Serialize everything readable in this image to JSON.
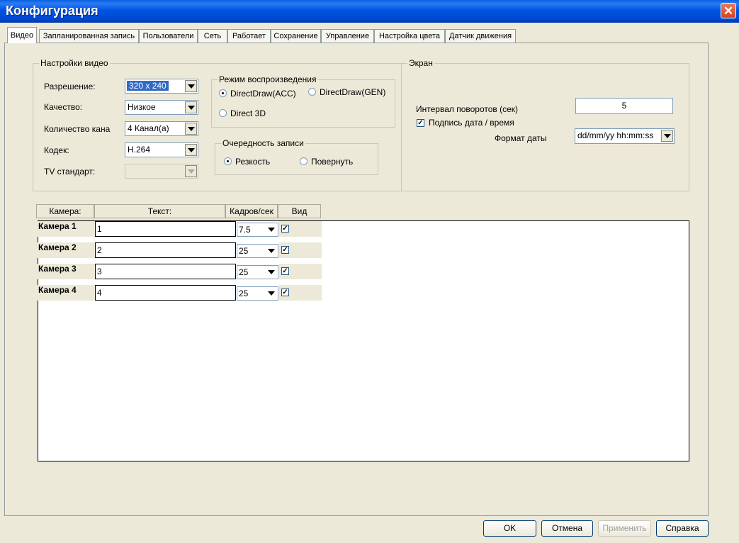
{
  "window": {
    "title": "Конфигурация"
  },
  "tabs": [
    "Видео",
    "Запланированная запись",
    "Пользователи",
    "Сеть",
    "Работает",
    "Сохранение",
    "Управление",
    "Настройка цвета",
    "Датчик движения"
  ],
  "video_settings": {
    "legend": "Настройки видео",
    "resolution_label": "Разрешение:",
    "resolution_value": "320 x 240",
    "quality_label": "Качество:",
    "quality_value": "Низкое",
    "channels_label": "Количество кана",
    "channels_value": "4 Канал(а)",
    "codec_label": "Кодек:",
    "codec_value": "H.264",
    "tv_label": "TV стандарт:",
    "tv_value": ""
  },
  "playback_mode": {
    "legend": "Режим воспроизведения",
    "option1": "DirectDraw(ACC)",
    "option2": "DirectDraw(GEN)",
    "option3": "Direct 3D",
    "selected": "DirectDraw(ACC)"
  },
  "record_order": {
    "legend": "Очередность записи",
    "option1": "Резкость",
    "option2": "Повернуть",
    "selected": "Резкость"
  },
  "screen": {
    "legend": "Экран",
    "interval_label": "Интервал поворотов (сек)",
    "interval_value": "5",
    "caption_label": "Подпись дата / время",
    "caption_checked": true,
    "date_format_label": "Формат даты",
    "date_format_value": "dd/mm/yy hh:mm:ss"
  },
  "camera_table": {
    "headers": [
      "Камера:",
      "Текст:",
      "Кадров/сек",
      "Вид"
    ],
    "rows": [
      {
        "name": "Камера 1",
        "text": "1",
        "fps": "7.5",
        "view": true
      },
      {
        "name": "Камера 2",
        "text": "2",
        "fps": "25",
        "view": true
      },
      {
        "name": "Камера 3",
        "text": "3",
        "fps": "25",
        "view": true
      },
      {
        "name": "Камера 4",
        "text": "4",
        "fps": "25",
        "view": true
      }
    ]
  },
  "buttons": {
    "ok": "OK",
    "cancel": "Отмена",
    "apply": "Применить",
    "help": "Справка"
  }
}
